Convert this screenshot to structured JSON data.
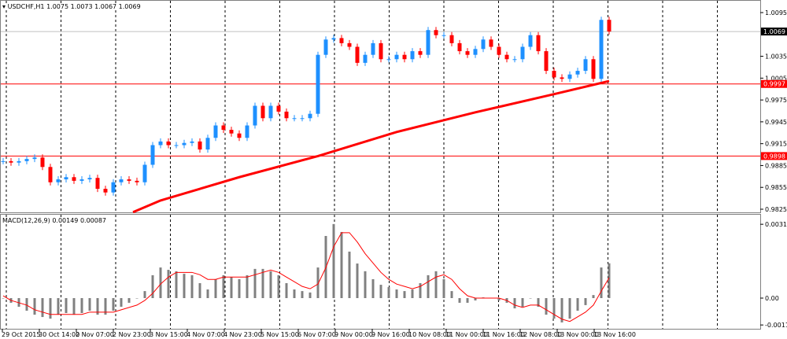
{
  "header": {
    "symbol": "USDCHF,H1",
    "ohlc": "1.0075 1.0073 1.0067 1.0069"
  },
  "macd_header": {
    "label": "MACD(12,26,9)",
    "values": "0.00149 0.00087"
  },
  "colors": {
    "bull": "#1e90ff",
    "bear": "#ff0000",
    "ma": "#ff0000",
    "hline": "#ff0000",
    "signal": "#ff0000",
    "hist": "#808080"
  },
  "chart_data": [
    {
      "type": "candlestick",
      "title": "USDCHF,H1",
      "ylim": [
        0.9818,
        1.0102
      ],
      "yticks": [
        "1.0095",
        "1.0035",
        "1.0005",
        "0.9975",
        "0.9945",
        "0.9915",
        "0.9885",
        "0.9855",
        "0.9825"
      ],
      "xticks": [
        "29 Oct 2015",
        "30 Oct 14:00",
        "2 Nov 07:00",
        "2 Nov 23:00",
        "3 Nov 15:00",
        "4 Nov 07:00",
        "4 Nov 23:00",
        "5 Nov 15:00",
        "6 Nov 07:00",
        "9 Nov 00:00",
        "9 Nov 16:00",
        "10 Nov 08:00",
        "11 Nov 00:00",
        "11 Nov 16:00",
        "12 Nov 08:00",
        "13 Nov 00:00",
        "13 Nov 16:00"
      ],
      "close": [
        0.9891,
        0.9889,
        0.9891,
        0.9894,
        0.9896,
        0.9883,
        0.9862,
        0.9866,
        0.9869,
        0.9864,
        0.9866,
        0.9868,
        0.9853,
        0.9848,
        0.9862,
        0.9866,
        0.9864,
        0.9862,
        0.9886,
        0.9913,
        0.9918,
        0.9913,
        0.9913,
        0.9916,
        0.9918,
        0.9907,
        0.9923,
        0.994,
        0.9934,
        0.9929,
        0.9923,
        0.994,
        0.9967,
        0.995,
        0.9967,
        0.9959,
        0.995,
        0.995,
        0.995,
        0.9956,
        1.0037,
        1.0058,
        1.006,
        1.0053,
        1.0048,
        1.0026,
        1.0037,
        1.0053,
        1.0031,
        1.0031,
        1.0037,
        1.0031,
        1.0042,
        1.0037,
        1.0071,
        1.0064,
        1.0064,
        1.0053,
        1.0042,
        1.0037,
        1.0045,
        1.0058,
        1.0048,
        1.0037,
        1.0031,
        1.0031,
        1.0048,
        1.0064,
        1.0042,
        1.0015,
        1.0006,
        1.0004,
        1.001,
        1.0015,
        1.0031,
        1.0004,
        1.0085,
        1.0069
      ],
      "moving_average": [
        [
          16.5,
          0.9821
        ],
        [
          20,
          0.9837
        ],
        [
          30,
          0.9869
        ],
        [
          40,
          0.9898
        ],
        [
          50,
          0.9931
        ],
        [
          60,
          0.9958
        ],
        [
          70,
          0.9983
        ],
        [
          77,
          1.0001
        ]
      ],
      "hlines": [
        {
          "value": 0.9997,
          "label": "0.9997"
        },
        {
          "value": 0.9898,
          "label": "0.9898"
        }
      ],
      "last_price": {
        "value": 1.0069,
        "label": "1.0069"
      }
    },
    {
      "type": "bar",
      "title": "MACD(12,26,9)",
      "ylim": [
        -0.00118,
        0.0033
      ],
      "yticks": [
        "0.00316",
        "0.00",
        "-0.00115"
      ],
      "histogram": [
        0,
        -0.0002,
        -0.00037,
        -0.00054,
        -0.00071,
        -0.00081,
        -0.00088,
        -0.00071,
        -0.00064,
        -0.00071,
        -0.00064,
        -0.00054,
        -0.00071,
        -0.00071,
        -0.00054,
        -0.00037,
        -0.0002,
        0,
        0.0003,
        0.00098,
        0.00131,
        0.00121,
        0.00115,
        0.00104,
        0.00098,
        0.00064,
        0.00037,
        0.00081,
        0.00098,
        0.00091,
        0.00081,
        0.00098,
        0.00125,
        0.00125,
        0.00115,
        0.00098,
        0.00064,
        0.00037,
        0.0003,
        0.00024,
        0.00131,
        0.00266,
        0.00317,
        0.00283,
        0.00199,
        0.00148,
        0.00115,
        0.00081,
        0.00057,
        0.00047,
        0.00037,
        0.0003,
        0.00037,
        0.00064,
        0.00098,
        0.00115,
        0.00081,
        0.0003,
        -0.0002,
        -0.0002,
        -0.0001,
        3e-05,
        0,
        -0.0001,
        -0.0002,
        -0.00044,
        -0.00037,
        0,
        -0.00037,
        -0.00071,
        -0.00088,
        -0.00104,
        -0.00088,
        -0.00054,
        -0.0003,
        0.00013,
        0.00131,
        0.00149
      ],
      "signal": [
        0.0001,
        -0.0001,
        -0.0002,
        -0.0003,
        -0.0005,
        -0.0006,
        -0.0007,
        -0.0007,
        -0.0007,
        -0.0007,
        -0.0007,
        -0.0006,
        -0.0006,
        -0.0006,
        -0.0006,
        -0.0005,
        -0.0004,
        -0.0003,
        -0.0001,
        0.0002,
        0.0006,
        0.0009,
        0.0011,
        0.0011,
        0.0011,
        0.001,
        0.0008,
        0.0008,
        0.0009,
        0.0009,
        0.0009,
        0.0009,
        0.001,
        0.0011,
        0.0012,
        0.0011,
        0.0009,
        0.0007,
        0.0005,
        0.0004,
        0.0006,
        0.0013,
        0.0022,
        0.0028,
        0.0028,
        0.0024,
        0.0019,
        0.0015,
        0.0011,
        0.0008,
        0.0006,
        0.0005,
        0.0004,
        0.0005,
        0.0007,
        0.0009,
        0.001,
        0.0008,
        0.0004,
        0.0001,
        0,
        0,
        0,
        0,
        -0.0001,
        -0.0003,
        -0.0004,
        -0.0003,
        -0.0003,
        -0.0005,
        -0.0007,
        -0.0009,
        -0.001,
        -0.0008,
        -0.0006,
        -0.0003,
        0.0003,
        0.00087
      ]
    }
  ]
}
